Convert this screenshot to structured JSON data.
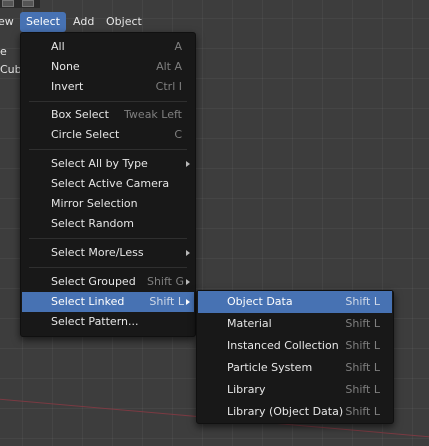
{
  "header": {
    "view_label": "ew",
    "select_label": "Select",
    "add_label": "Add",
    "object_label": "Object"
  },
  "outliner_fragments": [
    "e",
    "Cub"
  ],
  "select_menu": {
    "items": [
      {
        "label": "All",
        "shortcut": "A"
      },
      {
        "label": "None",
        "shortcut": "Alt A"
      },
      {
        "label": "Invert",
        "shortcut": "Ctrl I"
      },
      {
        "label": "Box Select",
        "shortcut": "Tweak Left"
      },
      {
        "label": "Circle Select",
        "shortcut": "C"
      },
      {
        "label": "Select All by Type",
        "shortcut": ""
      },
      {
        "label": "Select Active Camera",
        "shortcut": ""
      },
      {
        "label": "Mirror Selection",
        "shortcut": ""
      },
      {
        "label": "Select Random",
        "shortcut": ""
      },
      {
        "label": "Select More/Less",
        "shortcut": ""
      },
      {
        "label": "Select Grouped",
        "shortcut": "Shift G"
      },
      {
        "label": "Select Linked",
        "shortcut": "Shift L"
      },
      {
        "label": "Select Pattern...",
        "shortcut": ""
      }
    ]
  },
  "linked_submenu": {
    "items": [
      {
        "label": "Object Data",
        "shortcut": "Shift L"
      },
      {
        "label": "Material",
        "shortcut": "Shift L"
      },
      {
        "label": "Instanced Collection",
        "shortcut": "Shift L"
      },
      {
        "label": "Particle System",
        "shortcut": "Shift L"
      },
      {
        "label": "Library",
        "shortcut": "Shift L"
      },
      {
        "label": "Library (Object Data)",
        "shortcut": "Shift L"
      }
    ]
  },
  "colors": {
    "highlight": "#4772b3",
    "menu_bg": "#181818",
    "viewport_bg": "#3d3d3d",
    "shortcut_text": "#7f7f7f"
  }
}
